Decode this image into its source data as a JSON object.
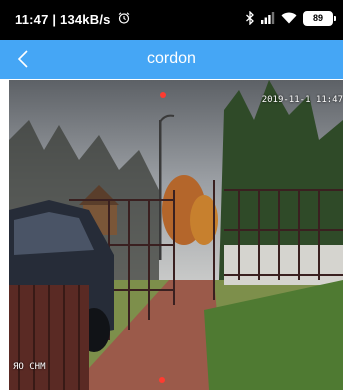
{
  "status_bar": {
    "time": "11:47",
    "network_speed": "134kB/s",
    "alarm_icon": "alarm-clock-icon",
    "icons": [
      "bluetooth-icon",
      "signal-icon",
      "wifi-icon"
    ],
    "battery_level": "89"
  },
  "nav": {
    "back_icon": "chevron-left-icon",
    "title": "cordon"
  },
  "camera_view": {
    "timestamp": "2019-11-1 11:47",
    "channel_label": "ЯО СНМ"
  },
  "colors": {
    "nav_bar": "#45a6f5",
    "status_bar": "#000000",
    "ptz_marker": "#ff3b30"
  }
}
